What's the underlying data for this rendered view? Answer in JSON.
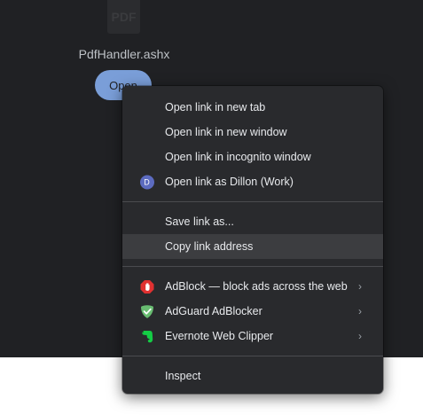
{
  "page": {
    "file_name": "PdfHandler.ashx",
    "file_icon_text": "PDF",
    "open_button_label": "Open"
  },
  "context_menu": {
    "items": [
      {
        "label": "Open link in new tab"
      },
      {
        "label": "Open link in new window"
      },
      {
        "label": "Open link in incognito window"
      },
      {
        "label": "Open link as Dillon (Work)",
        "avatar_letter": "D"
      },
      {
        "label": "Save link as..."
      },
      {
        "label": "Copy link address",
        "highlighted": true
      },
      {
        "label": "AdBlock — block ads across the web",
        "icon": "adblock-icon",
        "submenu": true
      },
      {
        "label": "AdGuard AdBlocker",
        "icon": "adguard-icon",
        "submenu": true
      },
      {
        "label": "Evernote Web Clipper",
        "icon": "evernote-icon",
        "submenu": true
      },
      {
        "label": "Inspect"
      }
    ],
    "submenu_arrow": "›"
  },
  "colors": {
    "page_bg": "#202124",
    "menu_bg": "#292a2d",
    "highlight_bg": "#3c3d40",
    "open_button": "#8ab4f8",
    "adblock_red": "#e03131",
    "adguard_green": "#68bc71",
    "evernote_green": "#14cc45"
  }
}
